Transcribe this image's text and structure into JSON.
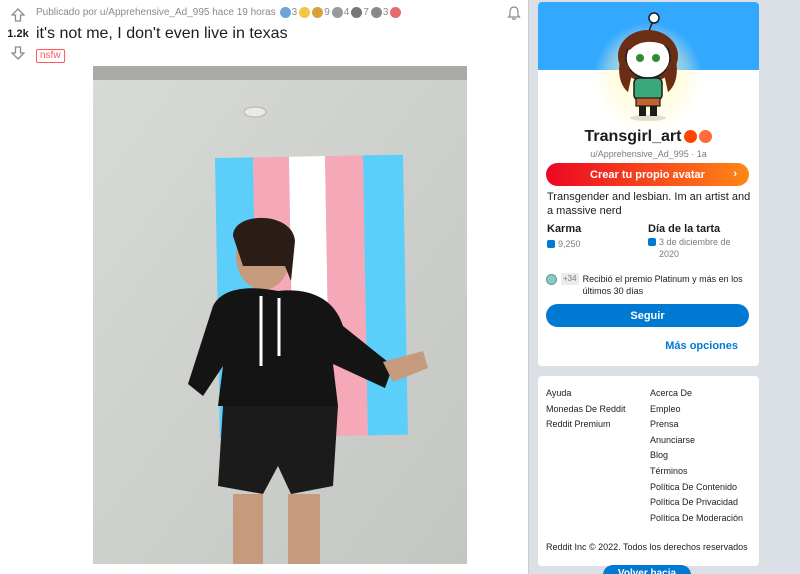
{
  "post": {
    "score": "1.2k",
    "byline": "Publicado por u/Apprehensive_Ad_995 hace 19 horas",
    "awards": [
      {
        "icon": "award-blue-icon",
        "color": "#6fa2d6",
        "count": "3"
      },
      {
        "icon": "award-face-icon",
        "color": "#f2c744",
        "count": ""
      },
      {
        "icon": "award-gold-icon",
        "color": "#d9a13b",
        "count": "9"
      },
      {
        "icon": "award-swirl-icon",
        "color": "#999999",
        "count": "4"
      },
      {
        "icon": "award-trophy-icon",
        "color": "#777777",
        "count": "7"
      },
      {
        "icon": "award-hand-icon",
        "color": "#888888",
        "count": "3"
      },
      {
        "icon": "award-pink-icon",
        "color": "#e56b6f",
        "count": ""
      }
    ],
    "title": "it's not me, I don't even live in texas",
    "tag": "nsfw"
  },
  "profile": {
    "display_name": "Transgirl_art",
    "handle": "u/Apprehensive_Ad_995 · 1a",
    "create_avatar_label": "Crear tu propio avatar",
    "bio": "Transgender and lesbian. Im an artist and a massive nerd",
    "karma_label": "Karma",
    "karma_value": "9,250",
    "cake_label": "Día de la tarta",
    "cake_value": "3 de diciembre de 2020",
    "trophy_count": "+34",
    "trophy_text": "Recibió el premio Platinum y más en los últimos 30 días",
    "follow_label": "Seguir",
    "more_options_label": "Más opciones"
  },
  "footer": {
    "left": [
      "Ayuda",
      "Monedas De Reddit",
      "Reddit Premium"
    ],
    "right": [
      "Acerca De",
      "Empleo",
      "Prensa",
      "Anunciarse",
      "Blog",
      "Términos",
      "Política De Contenido",
      "Política De Privacidad",
      "Política De Moderación"
    ],
    "copyright": "Reddit Inc © 2022. Todos los derechos reservados"
  },
  "back_to_top_label": "Volver hacia arriba",
  "colors": {
    "upvote": "#878a8c",
    "nsfw": "#ff585b",
    "primary_blue": "#0079d3",
    "banner": "#33a8ff"
  }
}
